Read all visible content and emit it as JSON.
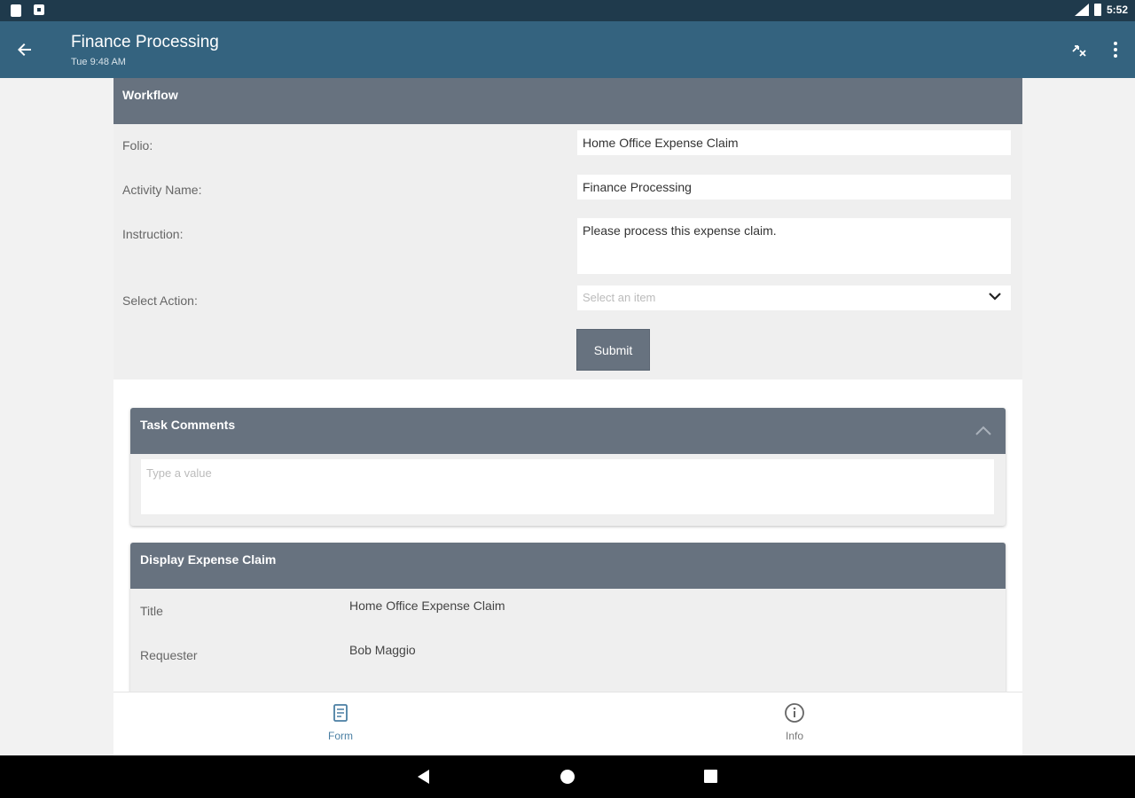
{
  "status_bar": {
    "time": "5:52"
  },
  "app_bar": {
    "title": "Finance Processing",
    "subtitle": "Tue 9:48 AM",
    "icons": [
      "back-arrow-icon",
      "workflow-icon",
      "more-vert-icon"
    ]
  },
  "workflow": {
    "header": "Workflow",
    "fields": {
      "folio": {
        "label": "Folio:",
        "value": "Home Office Expense Claim"
      },
      "activity_name": {
        "label": "Activity Name:",
        "value": "Finance Processing"
      },
      "instruction": {
        "label": "Instruction:",
        "value": "Please process this expense claim."
      },
      "select_action": {
        "label": "Select Action:",
        "placeholder": "Select an item"
      }
    },
    "submit_label": "Submit"
  },
  "task_comments": {
    "header": "Task Comments",
    "placeholder": "Type a value"
  },
  "expense_claim": {
    "header": "Display Expense Claim",
    "rows": [
      {
        "label": "Title",
        "value": "Home Office Expense Claim"
      },
      {
        "label": "Requester",
        "value": "Bob Maggio"
      }
    ]
  },
  "bottom_nav": {
    "items": [
      {
        "label": "Form",
        "icon": "form-icon",
        "active": true
      },
      {
        "label": "Info",
        "icon": "info-icon",
        "active": false
      }
    ]
  },
  "colors": {
    "app_bar": "#34637f",
    "status_bar": "#1f3a4c",
    "section_header": "#67727f",
    "active_nav": "#4a7fa3"
  }
}
